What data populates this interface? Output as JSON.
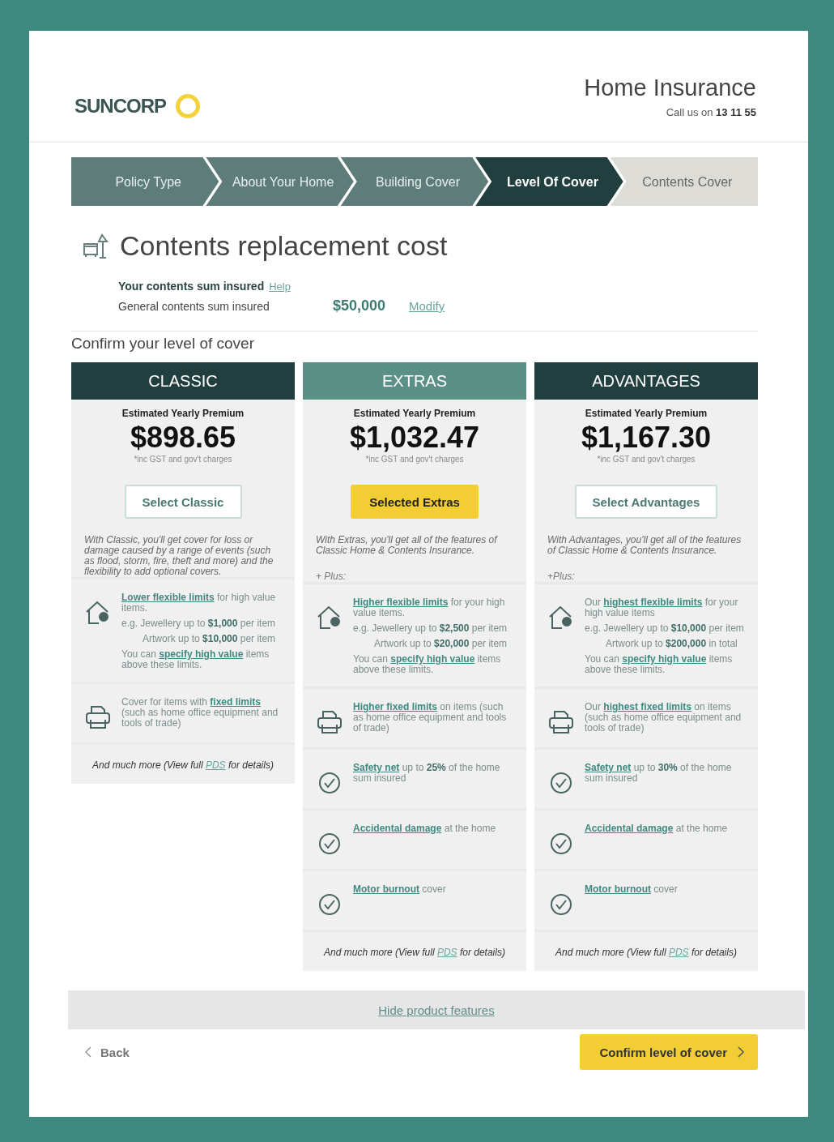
{
  "header": {
    "brand": "SUNCORP",
    "title": "Home Insurance",
    "call_label": "Call us on",
    "phone": "13 11 55"
  },
  "steps": [
    {
      "label": "Policy Type",
      "selected": false,
      "completed": true
    },
    {
      "label": "About Your Home",
      "selected": false,
      "completed": true
    },
    {
      "label": "Building Cover",
      "selected": false,
      "completed": true
    },
    {
      "label": "Level Of Cover",
      "selected": true,
      "completed": false
    },
    {
      "label": "Contents Cover",
      "selected": false,
      "completed": false
    }
  ],
  "section": {
    "title": "Contents replacement cost",
    "sum_label": "Your contents sum insured",
    "help": "Help",
    "row_label": "General contents sum insured",
    "amount": "$50,000",
    "modify": "Modify"
  },
  "confirm_heading": "Confirm your level of cover",
  "plans": [
    {
      "name": "CLASSIC",
      "selected": false,
      "premium_label": "Estimated Yearly Premium",
      "price": "$898.65",
      "note": "*inc GST and gov't charges",
      "button": "Select Classic",
      "description": "With Classic, you'll get cover for loss or damage caused by a range of events (such as flood, storm, fire, theft and more) and the flexibility to add optional covers.",
      "features": [
        {
          "kind": "house",
          "paragraphs": [
            {
              "kind": "text",
              "parts": [
                {
                  "kind": "link",
                  "text": "Lower flexible limits"
                },
                {
                  "kind": "plain",
                  "text": " for high value items."
                }
              ]
            },
            {
              "kind": "text",
              "parts": [
                {
                  "kind": "plain",
                  "text": "e.g. Jewellery up to "
                },
                {
                  "kind": "bold",
                  "text": "$1,000"
                },
                {
                  "kind": "plain",
                  "text": " per item"
                }
              ]
            },
            {
              "kind": "sub",
              "parts": [
                {
                  "kind": "plain",
                  "text": "Artwork up to "
                },
                {
                  "kind": "bold",
                  "text": "$10,000"
                },
                {
                  "kind": "plain",
                  "text": " per item"
                }
              ]
            },
            {
              "kind": "text",
              "parts": [
                {
                  "kind": "plain",
                  "text": "You can "
                },
                {
                  "kind": "link",
                  "text": "specify high value"
                },
                {
                  "kind": "plain",
                  "text": " items above these limits."
                }
              ]
            }
          ]
        },
        {
          "kind": "printer",
          "paragraphs": [
            {
              "kind": "text",
              "parts": [
                {
                  "kind": "plain",
                  "text": "Cover for items with "
                },
                {
                  "kind": "link",
                  "text": "fixed limits"
                },
                {
                  "kind": "plain",
                  "text": " (such as home office equipment and tools of trade)"
                }
              ]
            }
          ]
        }
      ],
      "more": [
        {
          "kind": "plain",
          "text": "And much more (View full "
        },
        {
          "kind": "link",
          "text": "PDS"
        },
        {
          "kind": "plain",
          "text": " for details)"
        }
      ]
    },
    {
      "name": "EXTRAS",
      "selected": true,
      "premium_label": "Estimated Yearly Premium",
      "price": "$1,032.47",
      "note": "*inc GST and gov't charges",
      "button": "Selected Extras",
      "description": "With Extras, you'll get all of the features of Classic Home & Contents Insurance.",
      "plus": "+ Plus:",
      "features": [
        {
          "kind": "house",
          "paragraphs": [
            {
              "kind": "text",
              "parts": [
                {
                  "kind": "link",
                  "text": "Higher flexible limits"
                },
                {
                  "kind": "plain",
                  "text": " for your high value items."
                }
              ]
            },
            {
              "kind": "text",
              "parts": [
                {
                  "kind": "plain",
                  "text": "e.g. Jewellery up to "
                },
                {
                  "kind": "bold",
                  "text": "$2,500"
                },
                {
                  "kind": "plain",
                  "text": " per item"
                }
              ]
            },
            {
              "kind": "sub",
              "parts": [
                {
                  "kind": "plain",
                  "text": "Artwork up to "
                },
                {
                  "kind": "bold",
                  "text": "$20,000"
                },
                {
                  "kind": "plain",
                  "text": " per item"
                }
              ]
            },
            {
              "kind": "text",
              "parts": [
                {
                  "kind": "plain",
                  "text": "You can "
                },
                {
                  "kind": "link",
                  "text": "specify high value"
                },
                {
                  "kind": "plain",
                  "text": " items above these limits."
                }
              ]
            }
          ]
        },
        {
          "kind": "printer",
          "paragraphs": [
            {
              "kind": "text",
              "parts": [
                {
                  "kind": "link",
                  "text": "Higher fixed limits"
                },
                {
                  "kind": "plain",
                  "text": " on items (such as home office equipment and tools of trade)"
                }
              ]
            }
          ]
        },
        {
          "kind": "check",
          "paragraphs": [
            {
              "kind": "text",
              "parts": [
                {
                  "kind": "link",
                  "text": "Safety net"
                },
                {
                  "kind": "plain",
                  "text": " up to "
                },
                {
                  "kind": "bold",
                  "text": "25%"
                },
                {
                  "kind": "plain",
                  "text": " of the home sum insured"
                }
              ]
            }
          ]
        },
        {
          "kind": "check",
          "paragraphs": [
            {
              "kind": "text",
              "parts": [
                {
                  "kind": "link",
                  "text": "Accidental damage"
                },
                {
                  "kind": "plain",
                  "text": " at the home"
                }
              ]
            }
          ]
        },
        {
          "kind": "check",
          "paragraphs": [
            {
              "kind": "text",
              "parts": [
                {
                  "kind": "link",
                  "text": "Motor burnout"
                },
                {
                  "kind": "plain",
                  "text": " cover"
                }
              ]
            }
          ]
        }
      ],
      "more": [
        {
          "kind": "plain",
          "text": "And much more (View full "
        },
        {
          "kind": "link",
          "text": "PDS"
        },
        {
          "kind": "plain",
          "text": " for details)"
        }
      ]
    },
    {
      "name": "ADVANTAGES",
      "selected": false,
      "premium_label": "Estimated Yearly Premium",
      "price": "$1,167.30",
      "note": "*inc GST and gov't charges",
      "button": "Select Advantages",
      "description": "With Advantages, you'll get all of the features of Classic Home & Contents Insurance.",
      "plus": "+Plus:",
      "features": [
        {
          "kind": "house",
          "paragraphs": [
            {
              "kind": "text",
              "parts": [
                {
                  "kind": "plain",
                  "text": "Our "
                },
                {
                  "kind": "link",
                  "text": "highest flexible limits"
                },
                {
                  "kind": "plain",
                  "text": " for your high value items"
                }
              ]
            },
            {
              "kind": "text",
              "parts": [
                {
                  "kind": "plain",
                  "text": "e.g. Jewellery up to "
                },
                {
                  "kind": "bold",
                  "text": "$10,000"
                },
                {
                  "kind": "plain",
                  "text": " per item"
                }
              ]
            },
            {
              "kind": "sub",
              "parts": [
                {
                  "kind": "plain",
                  "text": "Artwork up to "
                },
                {
                  "kind": "bold",
                  "text": "$200,000"
                },
                {
                  "kind": "plain",
                  "text": " in total"
                }
              ]
            },
            {
              "kind": "text",
              "parts": [
                {
                  "kind": "plain",
                  "text": "You can "
                },
                {
                  "kind": "link",
                  "text": "specify high value"
                },
                {
                  "kind": "plain",
                  "text": " items above these limits."
                }
              ]
            }
          ]
        },
        {
          "kind": "printer",
          "paragraphs": [
            {
              "kind": "text",
              "parts": [
                {
                  "kind": "plain",
                  "text": "Our "
                },
                {
                  "kind": "link",
                  "text": "highest fixed limits"
                },
                {
                  "kind": "plain",
                  "text": " on items (such as home office equipment and tools of trade)"
                }
              ]
            }
          ]
        },
        {
          "kind": "check",
          "paragraphs": [
            {
              "kind": "text",
              "parts": [
                {
                  "kind": "link",
                  "text": "Safety net"
                },
                {
                  "kind": "plain",
                  "text": " up to "
                },
                {
                  "kind": "bold",
                  "text": "30%"
                },
                {
                  "kind": "plain",
                  "text": " of the home sum insured"
                }
              ]
            }
          ]
        },
        {
          "kind": "check",
          "paragraphs": [
            {
              "kind": "text",
              "parts": [
                {
                  "kind": "link",
                  "text": "Accidental damage"
                },
                {
                  "kind": "plain",
                  "text": " at the home"
                }
              ]
            }
          ]
        },
        {
          "kind": "check",
          "paragraphs": [
            {
              "kind": "text",
              "parts": [
                {
                  "kind": "link",
                  "text": "Motor burnout"
                },
                {
                  "kind": "plain",
                  "text": " cover"
                }
              ]
            }
          ]
        }
      ],
      "more": [
        {
          "kind": "plain",
          "text": "And much more (View full "
        },
        {
          "kind": "link",
          "text": "PDS"
        },
        {
          "kind": "plain",
          "text": " for details)"
        }
      ]
    }
  ],
  "hide_features": "Hide product features",
  "footer": {
    "back": "Back",
    "confirm": "Confirm level of cover"
  }
}
